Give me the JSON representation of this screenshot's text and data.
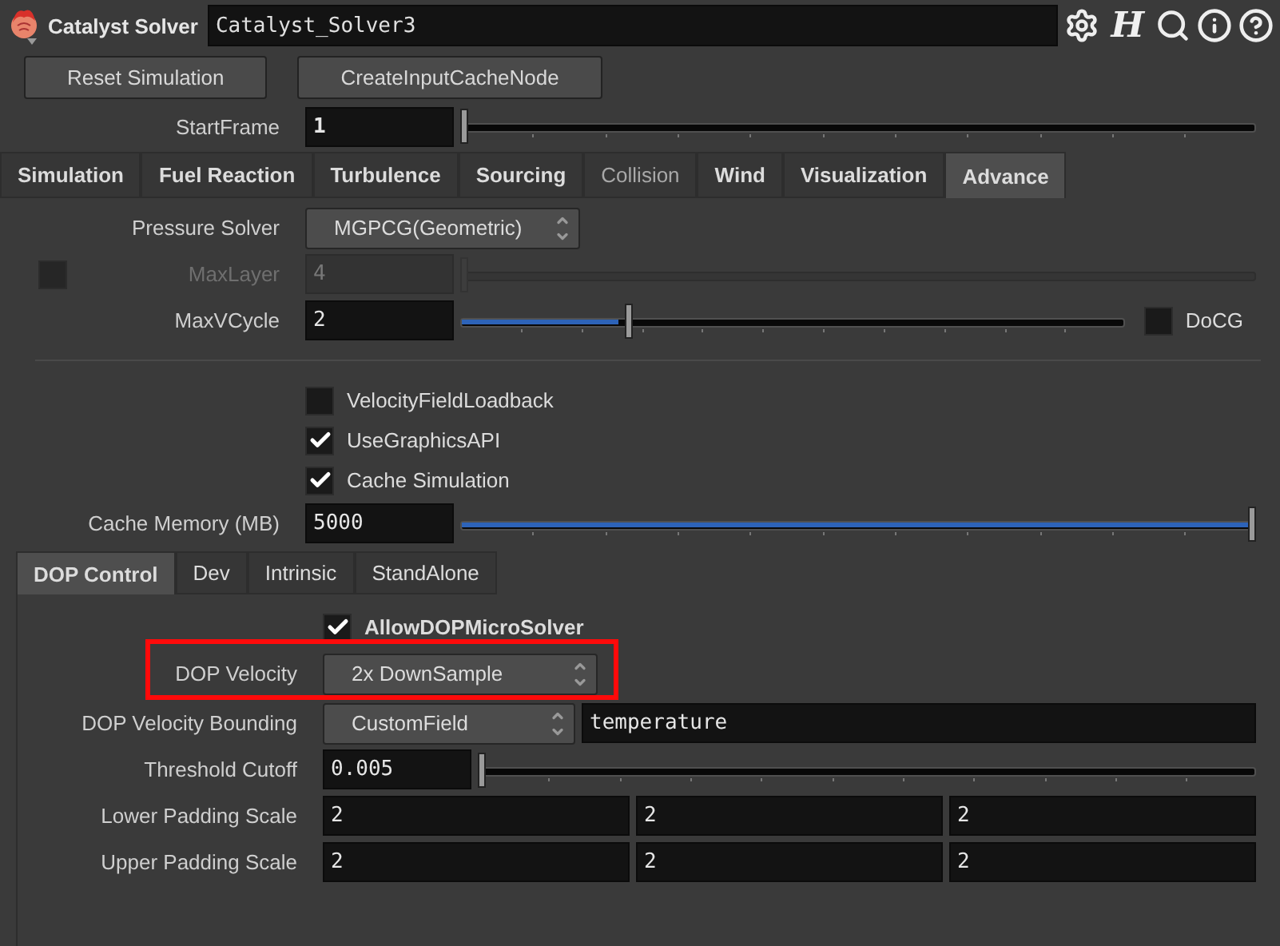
{
  "header": {
    "title": "Catalyst Solver",
    "node_name": "Catalyst_Solver3",
    "logo_letter": "H"
  },
  "buttons": [
    "Reset Simulation",
    "CreateInputCacheNode"
  ],
  "start_frame": {
    "label": "StartFrame",
    "value": "1",
    "level": 0
  },
  "tabs": [
    {
      "label": "Simulation",
      "selected": false,
      "disabled": false
    },
    {
      "label": "Fuel Reaction",
      "selected": false,
      "disabled": false
    },
    {
      "label": "Turbulence",
      "selected": false,
      "disabled": false
    },
    {
      "label": "Sourcing",
      "selected": false,
      "disabled": false
    },
    {
      "label": "Collision",
      "selected": false,
      "disabled": true
    },
    {
      "label": "Wind",
      "selected": false,
      "disabled": false
    },
    {
      "label": "Visualization",
      "selected": false,
      "disabled": false
    },
    {
      "label": "Advance",
      "selected": true,
      "disabled": false
    }
  ],
  "params": [
    {
      "kind": "menu",
      "label": "Pressure Solver",
      "value": "MGPCG(Geometric)"
    },
    {
      "kind": "slider",
      "label": "MaxLayer",
      "value": "4",
      "level": 0,
      "disabled": true,
      "toggle": {
        "checked": false
      }
    },
    {
      "kind": "slider",
      "label": "MaxVCycle",
      "value": "2",
      "level": 0.25,
      "disabled": false,
      "side_checkbox": {
        "label": "DoCG",
        "checked": false
      }
    },
    {
      "kind": "separator"
    },
    {
      "kind": "checkbox",
      "label": "VelocityFieldLoadback",
      "checked": false
    },
    {
      "kind": "checkbox",
      "label": "UseGraphicsAPI",
      "checked": true
    },
    {
      "kind": "checkbox",
      "label": "Cache Simulation",
      "checked": true
    },
    {
      "kind": "slider",
      "label": "Cache Memory (MB)",
      "value": "5000",
      "level": 1,
      "disabled": false
    }
  ],
  "subtabs": [
    {
      "label": "DOP Control",
      "selected": true
    },
    {
      "label": "Dev",
      "selected": false
    },
    {
      "label": "Intrinsic",
      "selected": false
    },
    {
      "label": "StandAlone",
      "selected": false
    }
  ],
  "sub_params": [
    {
      "kind": "checkbox",
      "label": "AllowDOPMicroSolver",
      "checked": true,
      "bold": true
    },
    {
      "kind": "menu",
      "label": "DOP Velocity",
      "value": "2x DownSample",
      "highlighted": true
    },
    {
      "kind": "menu_field",
      "label": "DOP Velocity Bounding",
      "value": "CustomField",
      "field": "temperature"
    },
    {
      "kind": "slider",
      "label": "Threshold Cutoff",
      "value": "0.005",
      "level": 0,
      "disabled": false
    },
    {
      "kind": "vector",
      "label": "Lower Padding Scale",
      "values": [
        "2",
        "2",
        "2"
      ]
    },
    {
      "kind": "vector",
      "label": "Upper Padding Scale",
      "values": [
        "2",
        "2",
        "2"
      ]
    }
  ]
}
